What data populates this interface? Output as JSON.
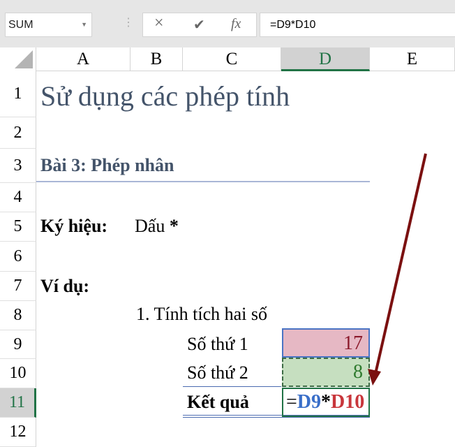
{
  "name_box": "SUM",
  "formula_bar": {
    "cancel_icon": "×",
    "enter_icon": "✔",
    "fx_label": "fx",
    "value": "=D9*D10"
  },
  "columns": [
    "A",
    "B",
    "C",
    "D",
    "E"
  ],
  "rows": [
    "1",
    "2",
    "3",
    "4",
    "5",
    "6",
    "7",
    "8",
    "9",
    "10",
    "11",
    "12"
  ],
  "cells": {
    "A1": "Sử dụng các phép tính",
    "A3": "Bài 3: Phép nhân",
    "A5": "Ký hiệu:",
    "B5": "Dấu ",
    "B5_star": "*",
    "A7": "Ví dụ:",
    "B8": "1. Tính tích hai số",
    "C9": "Số thứ 1",
    "D9": "17",
    "C10": "Số thứ 2",
    "D10": "8",
    "C11": "Kết quả",
    "D11": {
      "eq": "=",
      "ref1": "D9",
      "op": "*",
      "ref2": "D10"
    }
  },
  "colors": {
    "accent": "#217346",
    "title": "#44546a",
    "d9_fill": "#e6b8c4",
    "d10_fill": "#c6dfc0",
    "arrow": "#7b1010"
  }
}
